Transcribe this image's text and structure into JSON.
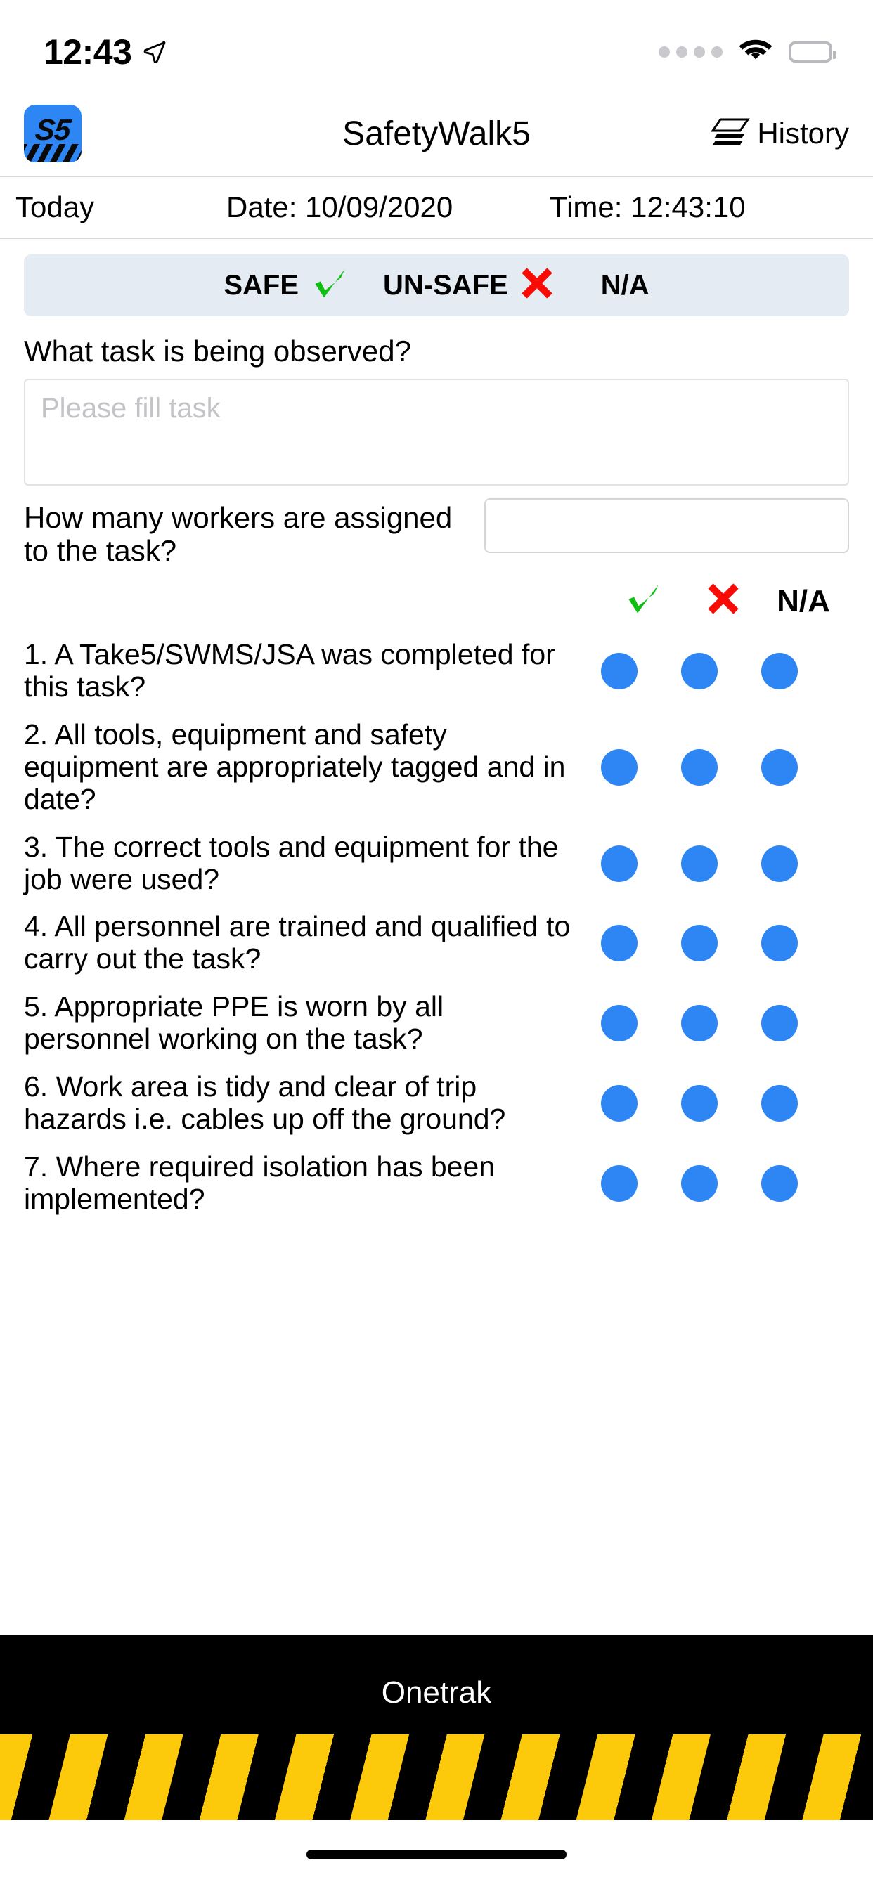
{
  "status_bar": {
    "time": "12:43",
    "location_icon": "location-arrow-icon",
    "signal_icon": "signal-dots-icon",
    "wifi_icon": "wifi-icon",
    "battery_icon": "battery-full-icon"
  },
  "nav": {
    "logo_text": "S5",
    "logo_name": "safetywalk5-app-logo",
    "title": "SafetyWalk5",
    "history_label": "History",
    "history_icon": "layers-stack-icon"
  },
  "date_row": {
    "today": "Today",
    "date": "Date: 10/09/2020",
    "time": "Time: 12:43:10"
  },
  "legend": {
    "safe_label": "SAFE",
    "safe_icon": "green-check-icon",
    "safe_glyph": "✔",
    "unsafe_label": "UN-SAFE",
    "unsafe_icon": "red-cross-icon",
    "unsafe_glyph": "✖",
    "na_label": "N/A"
  },
  "task": {
    "question": "What task is being observed?",
    "placeholder": "Please fill task",
    "value": ""
  },
  "workers": {
    "question": "How many workers are assigned to the task?",
    "value": "",
    "placeholder": ""
  },
  "columns": {
    "check_glyph": "✔",
    "cross_glyph": "✖",
    "na_label": "N/A"
  },
  "checklist": [
    {
      "text": "1. A Take5/SWMS/JSA was completed for this task?"
    },
    {
      "text": "2. All tools, equipment and safety equipment are appropriately tagged and in date?"
    },
    {
      "text": "3. The correct tools and equipment for the job were used?"
    },
    {
      "text": "4. All personnel are trained and qualified to carry out the task?"
    },
    {
      "text": "5. Appropriate PPE is worn by all personnel working on the task?"
    },
    {
      "text": "6. Work area is tidy and clear of trip hazards i.e. cables up off the ground?"
    },
    {
      "text": "7. Where required isolation has been implemented?"
    }
  ],
  "footer": {
    "brand": "Onetrak"
  },
  "colors": {
    "accent_blue": "#2e86f5",
    "safe_green": "#0fbf12",
    "unsafe_red": "#f90a05",
    "legend_bg": "#e4ebf3",
    "hazard_yellow": "#fdc90b"
  }
}
